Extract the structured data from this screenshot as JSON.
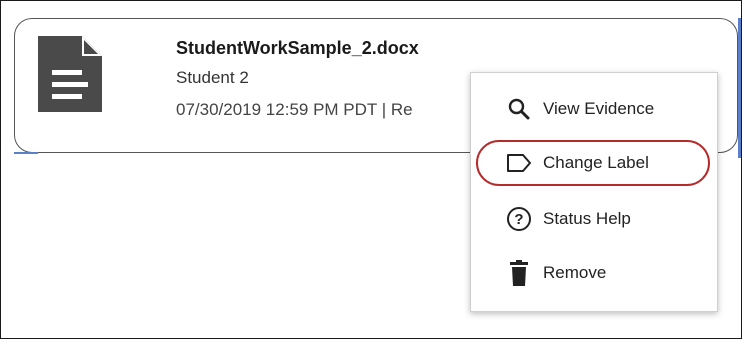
{
  "file_card": {
    "file_name": "StudentWorkSample_2.docx",
    "student": "Student 2",
    "meta": "07/30/2019 12:59 PM PDT | Re",
    "icon": "document-icon"
  },
  "context_menu": {
    "items": [
      {
        "label": "View Evidence",
        "icon": "search-icon"
      },
      {
        "label": "Change Label",
        "icon": "label-tag-icon"
      },
      {
        "label": "Status Help",
        "icon": "help-circle-icon"
      },
      {
        "label": "Remove",
        "icon": "trash-icon"
      }
    ]
  },
  "colors": {
    "highlight": "#b52a2a",
    "icon_dark": "#4a4a4a",
    "card_accent": "#5b7fc9"
  }
}
